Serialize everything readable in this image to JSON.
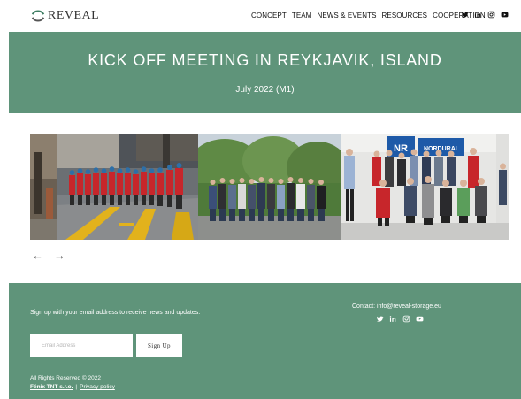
{
  "header": {
    "logo_text": "REVEAL",
    "nav": [
      {
        "label": "CONCEPT"
      },
      {
        "label": "TEAM"
      },
      {
        "label": "NEWS & EVENTS"
      },
      {
        "label": "RESOURCES"
      },
      {
        "label": "COOPERATION"
      }
    ],
    "active_nav": "RESOURCES",
    "social_icons": [
      "twitter-icon",
      "linkedin-icon",
      "instagram-icon",
      "youtube-icon"
    ]
  },
  "banner": {
    "title": "KICK OFF MEETING IN REYKJAVIK, ISLAND",
    "date": "July 2022 (M1)"
  },
  "gallery": {
    "arrow_prev": "←",
    "arrow_next": "→",
    "sign_text": "NORDURAL",
    "logo_box_text": "NR"
  },
  "footer": {
    "signup_text": "Sign up with your email address to receive news and updates.",
    "email_placeholder": "Email Address",
    "signup_button": "Sign Up",
    "contact": "Contact: info@reveal-storage.eu",
    "rights": "All Rights Reserved © 2022",
    "company": "Fénix TNT s.r.o.",
    "separator": "|",
    "privacy": "Privacy policy"
  },
  "colors": {
    "accent": "#5f947a",
    "worker_red": "#c7262b"
  }
}
